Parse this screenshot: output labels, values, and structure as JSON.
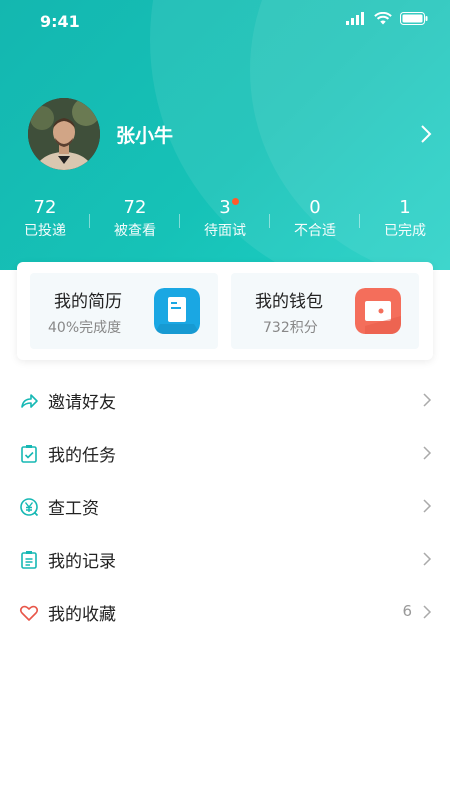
{
  "status_bar": {
    "time": "9:41"
  },
  "profile": {
    "name": "张小牛"
  },
  "stats": [
    {
      "value": "72",
      "label": "已投递"
    },
    {
      "value": "72",
      "label": "被查看"
    },
    {
      "value": "3",
      "label": "待面试",
      "dot": true
    },
    {
      "value": "0",
      "label": "不合适"
    },
    {
      "value": "1",
      "label": "已完成"
    }
  ],
  "cards": {
    "resume": {
      "title": "我的简历",
      "subtitle": "40%完成度"
    },
    "wallet": {
      "title": "我的钱包",
      "subtitle": "732积分"
    }
  },
  "menu": [
    {
      "label": "邀请好友",
      "icon": "share-icon"
    },
    {
      "label": "我的任务",
      "icon": "task-icon"
    },
    {
      "label": "查工资",
      "icon": "salary-icon"
    },
    {
      "label": "我的记录",
      "icon": "record-icon"
    },
    {
      "label": "我的收藏",
      "icon": "heart-icon",
      "count": "6"
    }
  ],
  "colors": {
    "header_start": "#14b7b0",
    "header_end": "#1fd0c6",
    "accent": "#16b8b4",
    "badge_dot": "#ff5a2a",
    "resume_icon": "#1aa7e3",
    "wallet_icon": "#f46e5b",
    "heart_icon": "#e8574a"
  }
}
